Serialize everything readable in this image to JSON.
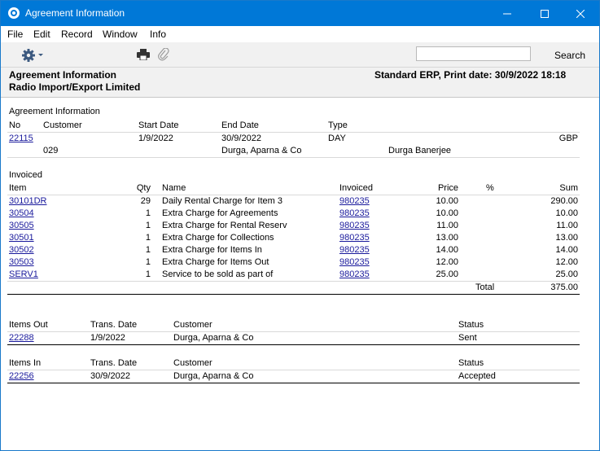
{
  "window": {
    "title": "Agreement Information"
  },
  "menu": [
    "File",
    "Edit",
    "Record",
    "Window",
    "Info"
  ],
  "toolbar": {
    "search_label": "Search",
    "search_value": ""
  },
  "report_header": {
    "left_line1": "Agreement Information",
    "left_line2": "Radio Import/Export Limited",
    "right_line1": "Standard ERP, Print date: 30/9/2022 18:18"
  },
  "agreement": {
    "section_title": "Agreement Information",
    "headers": {
      "no": "No",
      "customer": "Customer",
      "start": "Start Date",
      "end": "End Date",
      "type": "Type"
    },
    "no": "22115",
    "start": "1/9/2022",
    "end": "30/9/2022",
    "type": "DAY",
    "currency": "GBP",
    "customer_code": "029",
    "customer_name": "Durga, Aparna & Co",
    "contact": "Durga Banerjee"
  },
  "invoiced": {
    "section_title": "Invoiced",
    "headers": {
      "item": "Item",
      "qty": "Qty",
      "name": "Name",
      "invoiced": "Invoiced",
      "price": "Price",
      "pct": "%",
      "sum": "Sum"
    },
    "rows": [
      {
        "item": "30101DR",
        "qty": "29",
        "name": "Daily Rental Charge for Item 3",
        "invoiced": "980235",
        "price": "10.00",
        "sum": "290.00"
      },
      {
        "item": "30504",
        "qty": "1",
        "name": "Extra Charge for Agreements",
        "invoiced": "980235",
        "price": "10.00",
        "sum": "10.00"
      },
      {
        "item": "30505",
        "qty": "1",
        "name": "Extra Charge for Rental Reserv",
        "invoiced": "980235",
        "price": "11.00",
        "sum": "11.00"
      },
      {
        "item": "30501",
        "qty": "1",
        "name": "Extra Charge for Collections",
        "invoiced": "980235",
        "price": "13.00",
        "sum": "13.00"
      },
      {
        "item": "30502",
        "qty": "1",
        "name": "Extra Charge for Items In",
        "invoiced": "980235",
        "price": "14.00",
        "sum": "14.00"
      },
      {
        "item": "30503",
        "qty": "1",
        "name": "Extra Charge for Items Out",
        "invoiced": "980235",
        "price": "12.00",
        "sum": "12.00"
      },
      {
        "item": "SERV1",
        "qty": "1",
        "name": "Service to be sold as part of",
        "invoiced": "980235",
        "price": "25.00",
        "sum": "25.00"
      }
    ],
    "total_label": "Total",
    "total_value": "375.00"
  },
  "items_out": {
    "headers": {
      "col1": "Items Out",
      "date": "Trans. Date",
      "customer": "Customer",
      "status": "Status"
    },
    "rows": [
      {
        "no": "22288",
        "date": "1/9/2022",
        "customer": "Durga, Aparna & Co",
        "status": "Sent"
      }
    ]
  },
  "items_in": {
    "headers": {
      "col1": "Items In",
      "date": "Trans. Date",
      "customer": "Customer",
      "status": "Status"
    },
    "rows": [
      {
        "no": "22256",
        "date": "30/9/2022",
        "customer": "Durga, Aparna & Co",
        "status": "Accepted"
      }
    ]
  }
}
